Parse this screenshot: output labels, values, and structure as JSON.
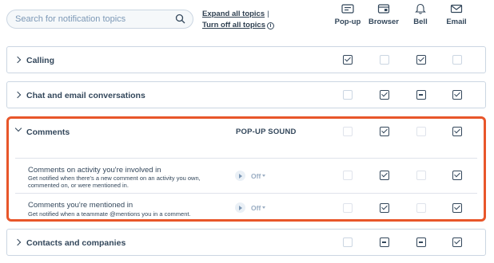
{
  "search": {
    "placeholder": "Search for notification topics",
    "icon": "search-icon"
  },
  "links": {
    "expand_all": "Expand all topics",
    "separator": "|",
    "turn_off_all": "Turn off all topics",
    "info_glyph": "i"
  },
  "columns": [
    {
      "label": "Pop-up",
      "icon": "popup-icon"
    },
    {
      "label": "Browser",
      "icon": "browser-icon"
    },
    {
      "label": "Bell",
      "icon": "bell-icon"
    },
    {
      "label": "Email",
      "icon": "email-icon"
    }
  ],
  "rows": [
    {
      "title": "Calling",
      "states": [
        "checked",
        "unchecked",
        "checked",
        "unchecked"
      ]
    },
    {
      "title": "Chat and email conversations",
      "states": [
        "unchecked",
        "checked",
        "indeterminate",
        "checked"
      ]
    },
    {
      "title": "Comments",
      "expanded": true,
      "sound_header": "POP-UP SOUND",
      "states": [
        "unchecked",
        "checked",
        "unchecked",
        "checked"
      ],
      "subtopics": [
        {
          "title": "Comments on activity you're involved in",
          "description": "Get notified when there's a new comment on an activity you own, commented on, or were mentioned in.",
          "sound": "Off",
          "states": [
            "unchecked",
            "checked",
            "unchecked",
            "checked"
          ]
        },
        {
          "title": "Comments you're mentioned in",
          "description": "Get notified when a teammate @mentions you in a comment.",
          "sound": "Off",
          "states": [
            "unchecked",
            "checked",
            "unchecked",
            "checked"
          ]
        }
      ]
    },
    {
      "title": "Contacts and companies",
      "states": [
        "unchecked",
        "indeterminate",
        "indeterminate",
        "checked"
      ]
    }
  ],
  "colors": {
    "highlight": "#e8562a",
    "text": "#33475b",
    "border": "#cbd6e2"
  }
}
